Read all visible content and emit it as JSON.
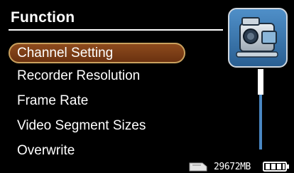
{
  "header": {
    "title": "Function"
  },
  "menu": {
    "items": [
      {
        "label": "Channel Setting",
        "selected": true
      },
      {
        "label": "Recorder Resolution",
        "selected": false
      },
      {
        "label": "Frame Rate",
        "selected": false
      },
      {
        "label": "Video Segment Sizes",
        "selected": false
      },
      {
        "label": "Overwrite",
        "selected": false
      }
    ]
  },
  "status": {
    "free_memory": "29672MB",
    "memory_icon": "sd-card-icon",
    "battery_icon": "battery-icon",
    "battery_level": 0.75
  },
  "icons": {
    "category_icon": "video-camera-icon"
  },
  "colors": {
    "background": "#000000",
    "selection_fill": "#7a3d15",
    "selection_border": "#c9a15e",
    "accent_blue": "#4a87c2",
    "text": "#ffffff"
  }
}
